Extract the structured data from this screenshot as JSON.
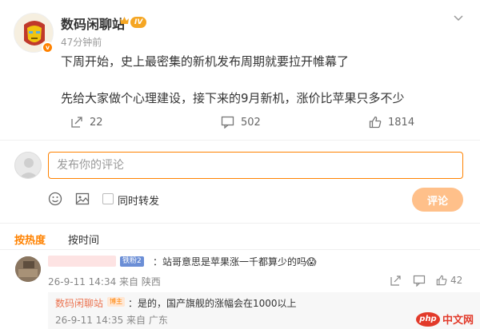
{
  "post": {
    "author": "数码闲聊站",
    "level_badge": "IV",
    "verified_badge": "v",
    "time": "47分钟前",
    "paragraph_1": "下周开始，史上最密集的新机发布周期就要拉开帷幕了",
    "paragraph_2": "先给大家做个心理建设，接下来的9月新机，涨价比苹果只多不少",
    "reposts": "22",
    "comments": "502",
    "likes": "1814"
  },
  "composer": {
    "placeholder": "发布你的评论",
    "repost_label": "同时转发",
    "submit_label": "评论"
  },
  "sort_tabs": {
    "hot": "按热度",
    "time": "按时间"
  },
  "comment": {
    "fan_badge": "铁粉2",
    "text": "：站哥意思是苹果涨一千都算少的吗😱",
    "meta": "26-9-11 14:34 来自 陕西",
    "likes": "42"
  },
  "reply": {
    "author": "数码闲聊站",
    "host_badge": "博主",
    "text": "：是的，国产旗舰的涨幅会在1000以上",
    "meta": "26-9-11 14:35 来自 广东"
  },
  "watermark": {
    "logo": "php",
    "text": "中文网"
  },
  "colors": {
    "accent": "#ff8200",
    "reply_name": "#eb7350",
    "watermark": "#e23a2a"
  },
  "icons": [
    "repost-icon",
    "comment-icon",
    "like-icon",
    "more-icon",
    "emoji-icon",
    "image-icon",
    "share-icon"
  ]
}
